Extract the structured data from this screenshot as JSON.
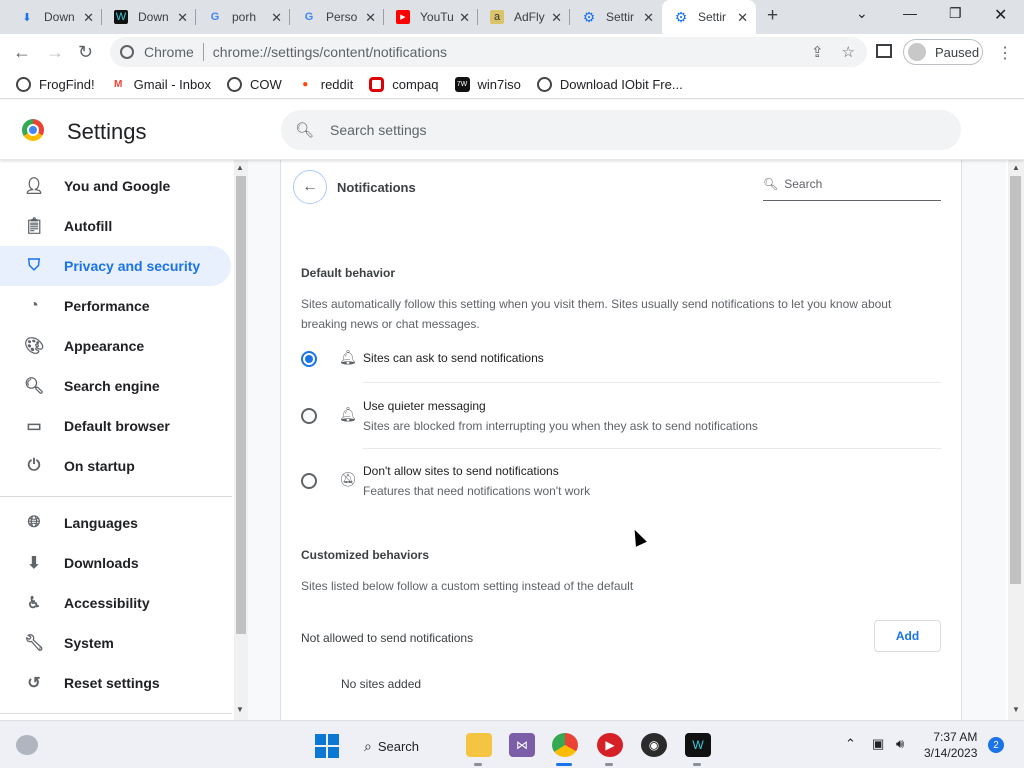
{
  "tabs": [
    {
      "title": "Down",
      "icon": "download-icon",
      "active": false
    },
    {
      "title": "Down",
      "icon": "winamp-icon",
      "active": false
    },
    {
      "title": "porh",
      "icon": "google-icon",
      "active": false
    },
    {
      "title": "Perso",
      "icon": "google-icon",
      "active": false
    },
    {
      "title": "YouTu",
      "icon": "youtube-icon",
      "active": false
    },
    {
      "title": "AdFly",
      "icon": "adfly-icon",
      "active": false
    },
    {
      "title": "Settir",
      "icon": "gear-icon",
      "active": false
    },
    {
      "title": "Settir",
      "icon": "gear-icon",
      "active": true
    }
  ],
  "omnibox": {
    "site": "Chrome",
    "url": "chrome://settings/content/notifications"
  },
  "profile": {
    "label": "Paused"
  },
  "bookmarks": [
    {
      "label": "FrogFind!",
      "icon": "globe-icon"
    },
    {
      "label": "Gmail - Inbox",
      "icon": "gmail-icon"
    },
    {
      "label": "COW",
      "icon": "globe-icon"
    },
    {
      "label": "reddit",
      "icon": "reddit-icon"
    },
    {
      "label": "compaq",
      "icon": "compaq-icon"
    },
    {
      "label": "win7iso",
      "icon": "win7iso-icon"
    },
    {
      "label": "Download IObit Fre...",
      "icon": "globe-icon"
    }
  ],
  "settings": {
    "title": "Settings",
    "search_placeholder": "Search settings"
  },
  "sidebar": {
    "items": [
      {
        "label": "You and Google",
        "icon": "person-icon"
      },
      {
        "label": "Autofill",
        "icon": "clipboard-icon"
      },
      {
        "label": "Privacy and security",
        "icon": "shield-icon"
      },
      {
        "label": "Performance",
        "icon": "speedometer-icon"
      },
      {
        "label": "Appearance",
        "icon": "palette-icon"
      },
      {
        "label": "Search engine",
        "icon": "search-icon"
      },
      {
        "label": "Default browser",
        "icon": "browser-icon"
      },
      {
        "label": "On startup",
        "icon": "power-icon"
      },
      {
        "label": "Languages",
        "icon": "globe-icon"
      },
      {
        "label": "Downloads",
        "icon": "download-icon"
      },
      {
        "label": "Accessibility",
        "icon": "accessibility-icon"
      },
      {
        "label": "System",
        "icon": "wrench-icon"
      },
      {
        "label": "Reset settings",
        "icon": "reset-icon"
      }
    ],
    "selected": "Privacy and security"
  },
  "page": {
    "title": "Notifications",
    "search_placeholder": "Search",
    "default_behavior": {
      "heading": "Default behavior",
      "description": "Sites automatically follow this setting when you visit them. Sites usually send notifications to let you know about breaking news or chat messages.",
      "options": [
        {
          "label": "Sites can ask to send notifications",
          "sub": "",
          "selected": true,
          "icon": "bell-icon"
        },
        {
          "label": "Use quieter messaging",
          "sub": "Sites are blocked from interrupting you when they ask to send notifications",
          "selected": false,
          "icon": "bell-icon"
        },
        {
          "label": "Don't allow sites to send notifications",
          "sub": "Features that need notifications won't work",
          "selected": false,
          "icon": "bell-off-icon"
        }
      ]
    },
    "customized": {
      "heading": "Customized behaviors",
      "description": "Sites listed below follow a custom setting instead of the default",
      "not_allowed_label": "Not allowed to send notifications",
      "add_label": "Add",
      "empty_label": "No sites added"
    }
  },
  "taskbar": {
    "search_label": "Search",
    "time": "7:37 AM",
    "date": "3/14/2023",
    "notification_count": "2"
  },
  "colors": {
    "accent": "#1a73e8",
    "selected_bg": "#e8f0fe"
  }
}
